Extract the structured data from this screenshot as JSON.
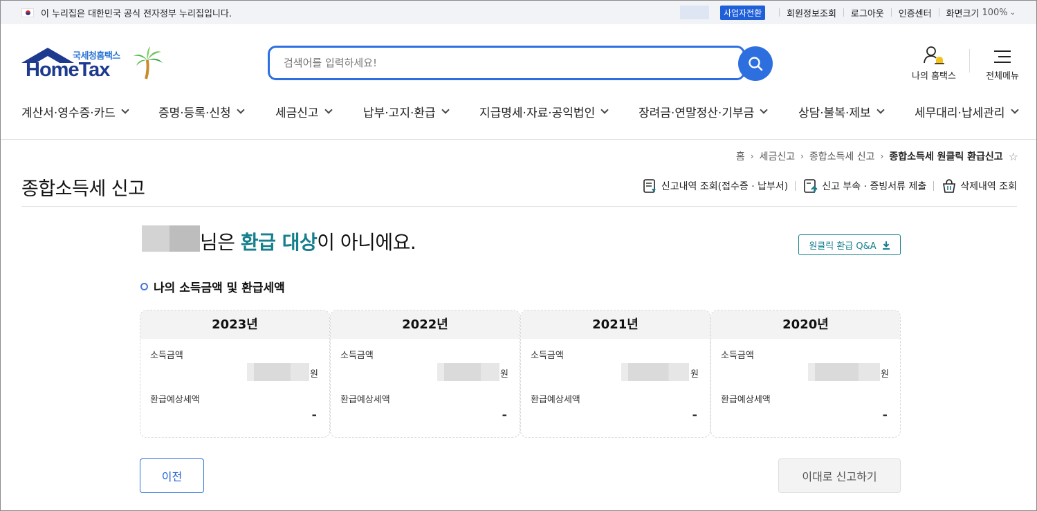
{
  "gov_bar": {
    "notice": "이 누리집은 대한민국 공식 전자정부 누리집입니다.",
    "biz_switch": "사업자전환",
    "links": [
      "회원정보조회",
      "로그아웃",
      "인증센터"
    ],
    "zoom_label": "화면크기",
    "zoom_value": "100%"
  },
  "logo": {
    "sub": "국세청홈택스",
    "main": "HomeTax"
  },
  "search": {
    "placeholder": "검색어를 입력하세요!"
  },
  "header": {
    "my_home": "나의 홈택스",
    "all_menu": "전체메뉴"
  },
  "nav": [
    "계산서·영수증·카드",
    "증명·등록·신청",
    "세금신고",
    "납부·고지·환급",
    "지급명세·자료·공익법인",
    "장려금·연말정산·기부금",
    "상담·불복·제보",
    "세무대리·납세관리"
  ],
  "breadcrumb": [
    "홈",
    "세금신고",
    "종합소득세 신고",
    "종합소득세 원클릭 환급신고"
  ],
  "page_title": "종합소득세 신고",
  "title_actions": [
    "신고내역 조회(접수증 · 납부서)",
    "신고 부속 · 증빙서류 제출",
    "삭제내역 조회"
  ],
  "result": {
    "suffix": "님은 ",
    "emphasis": "환급 대상",
    "tail": "이 아니에요."
  },
  "qa_button": "원클릭 환급 Q&A",
  "section_title": "나의 소득금액 및 환급세액",
  "cards": [
    {
      "year": "2023년",
      "income_label": "소득금액",
      "unit": "원",
      "refund_label": "환급예상세액",
      "refund_value": "-"
    },
    {
      "year": "2022년",
      "income_label": "소득금액",
      "unit": "원",
      "refund_label": "환급예상세액",
      "refund_value": "-"
    },
    {
      "year": "2021년",
      "income_label": "소득금액",
      "unit": "원",
      "refund_label": "환급예상세액",
      "refund_value": "-"
    },
    {
      "year": "2020년",
      "income_label": "소득금액",
      "unit": "원",
      "refund_label": "환급예상세액",
      "refund_value": "-"
    }
  ],
  "buttons": {
    "prev": "이전",
    "submit": "이대로 신고하기"
  },
  "colors": {
    "primary": "#2e6fe0",
    "teal": "#157f8d",
    "navy": "#1d3a8f"
  }
}
